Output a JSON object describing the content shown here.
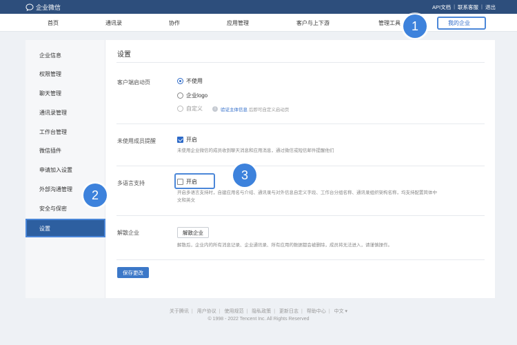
{
  "app": {
    "title": "企业微信"
  },
  "top_links": [
    "API文档",
    "联系客服",
    "退出"
  ],
  "nav": [
    "首页",
    "通讯录",
    "协作",
    "应用管理",
    "客户与上下游",
    "管理工具",
    "我的企业"
  ],
  "badges": [
    "1",
    "2",
    "3"
  ],
  "sidebar": [
    "企业信息",
    "权限管理",
    "聊天管理",
    "通讯录管理",
    "工作台管理",
    "微信插件",
    "申请加入设置",
    "外部沟通管理",
    "安全与保密",
    "设置"
  ],
  "content": {
    "title": "设置",
    "startup": {
      "label": "客户端启动页",
      "options": [
        "不使用",
        "企业logo",
        "自定义"
      ],
      "verify_link": "验证主体信息",
      "verify_suffix": "后即可自定义启动页"
    },
    "reminder": {
      "label": "未使用成员提醒",
      "checkbox": "开启",
      "desc": "未使用企业微信的成员收到聊天消息和应用消息，通过微信或短信邮件提醒他们"
    },
    "multilang": {
      "label": "多语言支持",
      "checkbox": "开启",
      "desc_line1": "开启多语言支持时，自建应用名与介绍、通讯录与对外信息自定义字段、工作台分组名称、通讯录组织架构名称，均支持配置简体中",
      "desc_line2": "文和英文"
    },
    "dissolve": {
      "label": "解散企业",
      "button": "解散企业",
      "desc": "解散后，企业内的所有消息记录、企业通讯录、所有应用的数据都会被删除，成员将无法进入，请谨慎操作。"
    },
    "save_button": "保存更改"
  },
  "footer": {
    "links": [
      "关于腾讯",
      "用户协议",
      "使用规范",
      "隐私政策",
      "更新日志",
      "帮助中心",
      "中文 ▾"
    ],
    "copyright": "© 1998 - 2022 Tencent Inc. All Rights Reserved"
  }
}
